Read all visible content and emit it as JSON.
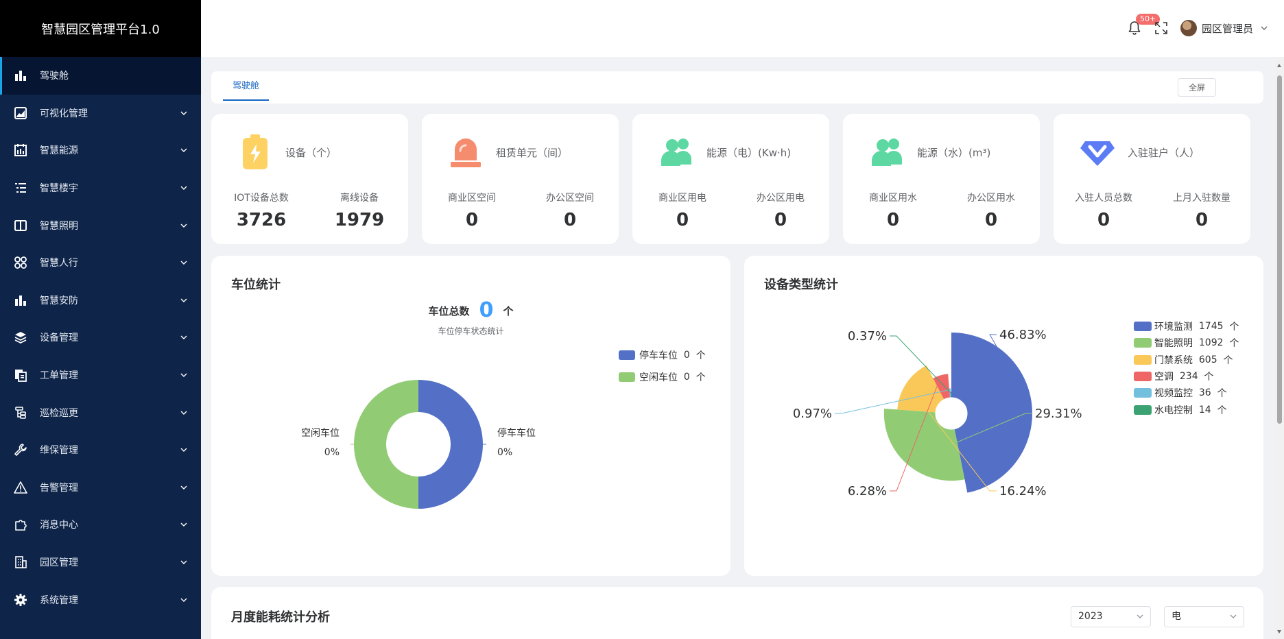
{
  "app": {
    "title": "智慧园区管理平台1.0"
  },
  "sidebar": {
    "items": [
      {
        "label": "驾驶舱",
        "icon": "bar-chart-icon"
      },
      {
        "label": "可视化管理",
        "icon": "area-chart-icon"
      },
      {
        "label": "智慧能源",
        "icon": "calendar-chart-icon"
      },
      {
        "label": "智慧楼宇",
        "icon": "list-icon"
      },
      {
        "label": "智慧照明",
        "icon": "panel-icon"
      },
      {
        "label": "智慧人行",
        "icon": "grid-circles-icon"
      },
      {
        "label": "智慧安防",
        "icon": "bar-chart-icon"
      },
      {
        "label": "设备管理",
        "icon": "layers-icon"
      },
      {
        "label": "工单管理",
        "icon": "documents-icon"
      },
      {
        "label": "巡检巡更",
        "icon": "tree-icon"
      },
      {
        "label": "维保管理",
        "icon": "wrench-icon"
      },
      {
        "label": "告警管理",
        "icon": "warning-icon"
      },
      {
        "label": "消息中心",
        "icon": "puzzle-icon"
      },
      {
        "label": "园区管理",
        "icon": "building-icon"
      },
      {
        "label": "系统管理",
        "icon": "gear-icon"
      }
    ]
  },
  "header": {
    "badge": "50+",
    "username": "园区管理员"
  },
  "tabs": {
    "active": "驾驶舱",
    "fullscreen_button": "全屏"
  },
  "stats": [
    {
      "title": "设备（个）",
      "icon": "battery-icon",
      "color": "#fdd263",
      "items": [
        {
          "label": "IOT设备总数",
          "value": "3726"
        },
        {
          "label": "离线设备",
          "value": "1979"
        }
      ]
    },
    {
      "title": "租赁单元（间）",
      "icon": "alarm-light-icon",
      "color": "#f58c6d",
      "items": [
        {
          "label": "商业区空间",
          "value": "0"
        },
        {
          "label": "办公区空间",
          "value": "0"
        }
      ]
    },
    {
      "title": "能源（电）(Kw·h)",
      "icon": "users-icon",
      "color": "#5ed8a2",
      "items": [
        {
          "label": "商业区用电",
          "value": "0"
        },
        {
          "label": "办公区用电",
          "value": "0"
        }
      ]
    },
    {
      "title": "能源（水）(m³)",
      "icon": "users-icon",
      "color": "#5ed8a2",
      "items": [
        {
          "label": "商业区用水",
          "value": "0"
        },
        {
          "label": "办公区用水",
          "value": "0"
        }
      ]
    },
    {
      "title": "入驻驻户（人）",
      "icon": "diamond-icon",
      "color": "#5b7cf5",
      "items": [
        {
          "label": "入驻人员总数",
          "value": "0"
        },
        {
          "label": "上月入驻数量",
          "value": "0"
        }
      ]
    }
  ],
  "parking": {
    "title": "车位统计",
    "total_label": "车位总数",
    "total_value": "0",
    "total_unit": "个",
    "subtitle": "车位停车状态统计",
    "legend": [
      {
        "label": "停车车位",
        "value": "0",
        "unit": "个",
        "color": "#5470c6"
      },
      {
        "label": "空闲车位",
        "value": "0",
        "unit": "个",
        "color": "#91cc75"
      }
    ]
  },
  "devices": {
    "title": "设备类型统计",
    "unit": "个"
  },
  "energy": {
    "title": "月度能耗统计分析",
    "year_select": "2023",
    "type_select": "电"
  },
  "chart_data": [
    {
      "type": "pie",
      "variant": "donut",
      "title": "车位统计",
      "labels": [
        "停车车位",
        "空闲车位"
      ],
      "values": [
        0,
        0
      ],
      "percent_labels": [
        "0%",
        "0%"
      ],
      "colors": [
        "#5470c6",
        "#91cc75"
      ],
      "legend": "top-right"
    },
    {
      "type": "pie",
      "variant": "rose",
      "title": "设备类型统计",
      "labels": [
        "环境监测",
        "智能照明",
        "门禁系统",
        "空调",
        "视频监控",
        "水电控制"
      ],
      "values": [
        1745,
        1092,
        605,
        234,
        36,
        14
      ],
      "percent_labels": [
        "46.83%",
        "29.31%",
        "16.24%",
        "6.28%",
        "0.97%",
        "0.37%"
      ],
      "colors": [
        "#5470c6",
        "#91cc75",
        "#fac858",
        "#ee6666",
        "#73c0de",
        "#3ba272"
      ],
      "legend": "right"
    }
  ]
}
